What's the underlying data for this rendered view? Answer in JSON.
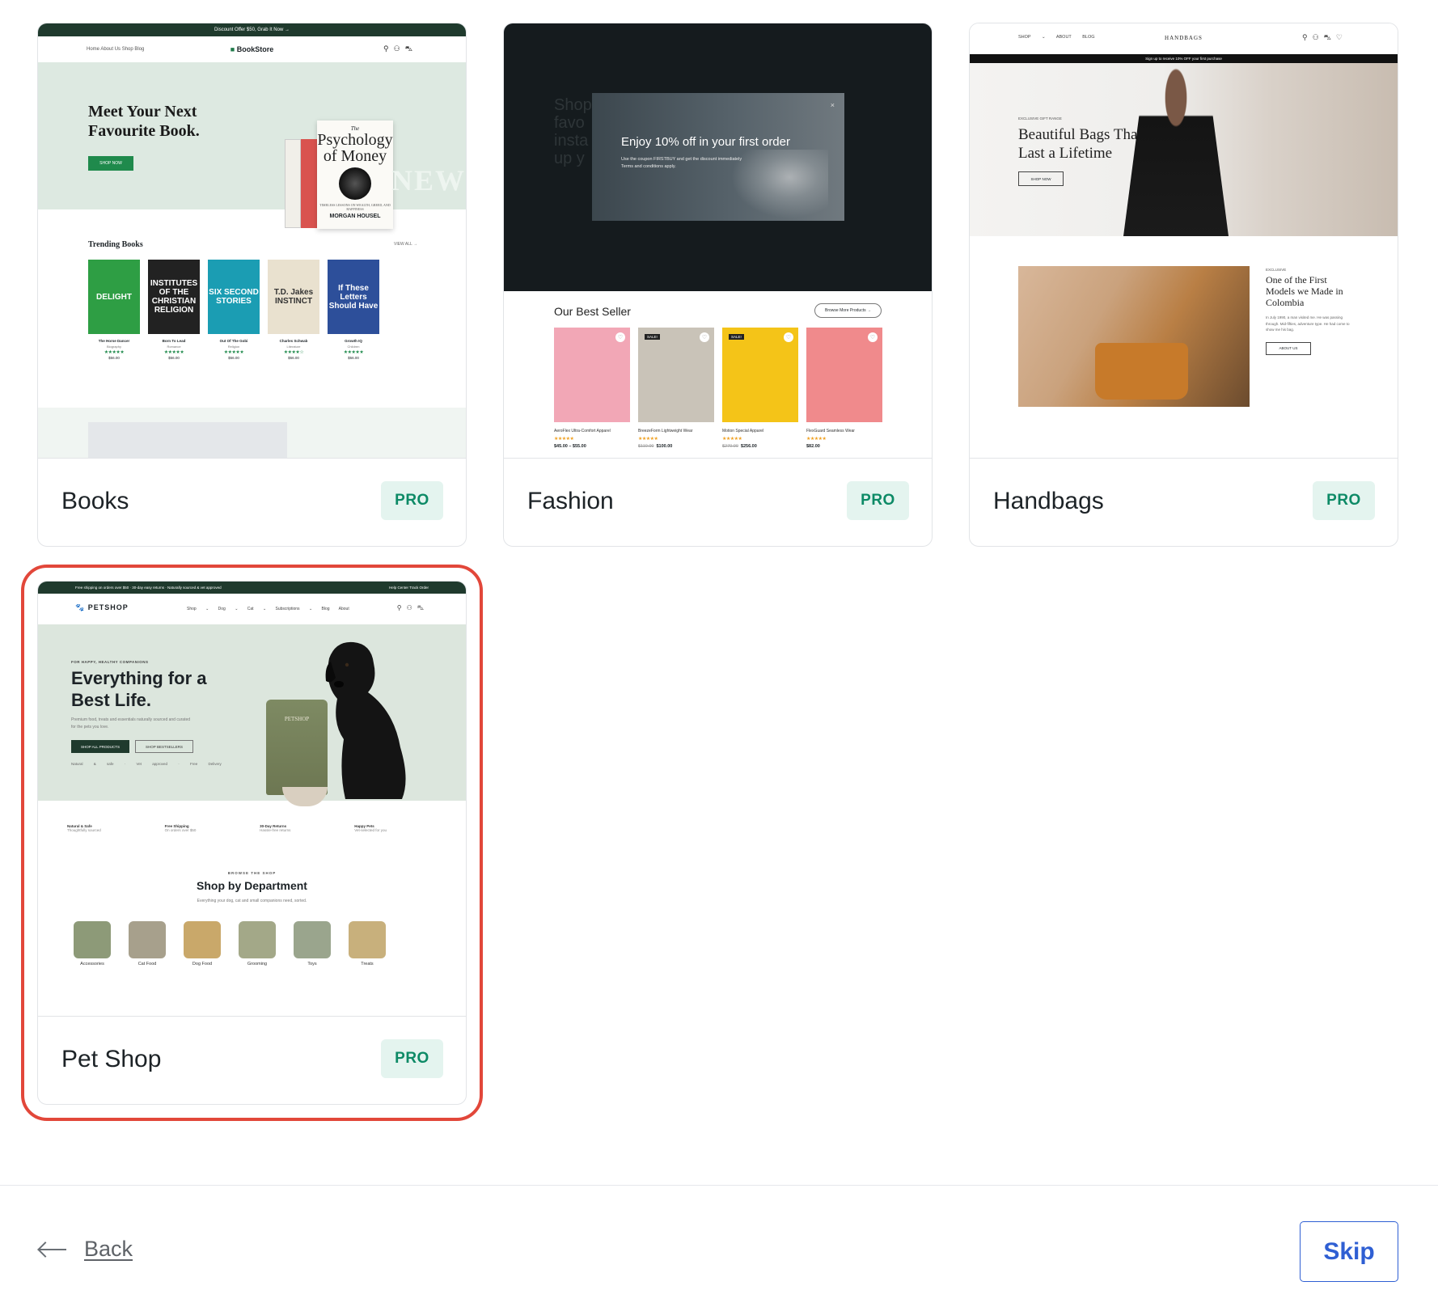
{
  "templates": [
    {
      "name": "Books",
      "badge": "PRO",
      "preview": {
        "topbar": "Discount Offer $50, Grab It Now →",
        "nav_links": "Home About Us Shop Blog",
        "logo": "BookStore",
        "hero_title": "Meet Your Next Favourite Book.",
        "hero_button": "SHOP NOW",
        "book_title_small": "The",
        "book_title": "Psychology of Money",
        "book_sub": "TIMELESS LESSONS ON WEALTH, GREED, AND HAPPINESS",
        "book_author": "MORGAN HOUSEL",
        "new_text": "NEW",
        "section_title": "Trending Books",
        "view_all": "VIEW ALL →",
        "books": [
          {
            "cover": "DELIGHT",
            "name": "The Horse Dancer",
            "cat": "Biography",
            "stars": "★★★★★",
            "price": "$56.00",
            "color": "#2e9e44"
          },
          {
            "cover": "INSTITUTES OF THE CHRISTIAN RELIGION",
            "name": "Born To Lead",
            "cat": "Romance",
            "stars": "★★★★★",
            "price": "$56.00",
            "color": "#222222"
          },
          {
            "cover": "SIX SECOND STORIES",
            "name": "Out Of The Gobi",
            "cat": "Religion",
            "stars": "★★★★★",
            "price": "$56.00",
            "color": "#1b9db3"
          },
          {
            "cover": "T.D. Jakes INSTINCT",
            "name": "Charles Schwab",
            "cat": "Literature",
            "stars": "★★★★☆",
            "price": "$56.00",
            "color": "#e9e1cf"
          },
          {
            "cover": "If These Letters Should Have",
            "name": "Growth IQ",
            "cat": "Children",
            "stars": "★★★★★",
            "price": "$56.00",
            "color": "#2d4f9a"
          }
        ]
      }
    },
    {
      "name": "Fashion",
      "badge": "PRO",
      "preview": {
        "ghost_text": "Shop favo insta up y",
        "modal_title": "Enjoy 10% off in your first order",
        "modal_text": "Use the coupon FIRSTBUY and get the discount immediately",
        "modal_terms": "Terms and conditions apply.",
        "modal_close": "×",
        "section_title": "Our Best Seller",
        "browse_button": "Browse More Products →",
        "products": [
          {
            "name": "AeroFlex Ultra-Comfort Apparel",
            "stars": "★★★★★",
            "old_price": "",
            "price": "$45.00 – $55.00",
            "sale": "",
            "color": "#f2a7b6"
          },
          {
            "name": "BreezeForm Lightweight Wear",
            "stars": "★★★★★",
            "old_price": "$110.00",
            "price": "$100.00",
            "sale": "SALE!",
            "color": "#c9c3b8"
          },
          {
            "name": "Motion Special Apparel",
            "stars": "★★★★★",
            "old_price": "$270.00",
            "price": "$256.00",
            "sale": "SALE!",
            "color": "#f4c418"
          },
          {
            "name": "FlexGuard Seamless Wear",
            "stars": "★★★★★",
            "old_price": "",
            "price": "$82.00",
            "sale": "",
            "color": "#f08a8c"
          }
        ]
      }
    },
    {
      "name": "Handbags",
      "badge": "PRO",
      "preview": {
        "nav_links": "SHOP ⌄ ABOUT BLOG",
        "logo": "HANDBAGS",
        "announcement": "Sign up to receive 10% OFF your first purchase",
        "kicker": "EXCLUSIVE GIFT RANGE",
        "hero_title": "Beautiful Bags That Last a Lifetime",
        "hero_button": "SHOP NOW",
        "kicker2": "EXCLUSIVE",
        "story_title": "One of the First Models we Made in Colombia",
        "story_text": "In July 1990, a man visited me. He was passing through. Mid-fifties, adventure type. He had come to show me his bag.",
        "story_button": "ABOUT US"
      }
    },
    {
      "name": "Pet Shop",
      "badge": "PRO",
      "selected": true,
      "preview": {
        "topbar_left": "Free shipping on orders over $50 · 30-day easy returns · Naturally sourced & vet approved",
        "topbar_right": "Help Center   Track Order",
        "logo": "PETSHOP",
        "nav_links": "Shop ⌄ Dog ⌄ Cat ⌄ Subscriptions ⌄ Blog About",
        "kicker": "FOR HAPPY, HEALTHY COMPANIONS",
        "hero_title": "Everything for a Best Life.",
        "hero_text": "Premium food, treats and essentials naturally sourced and curated for the pets you love.",
        "button_primary": "SHOP ALL PRODUCTS",
        "button_secondary": "SHOP BESTSELLERS",
        "hero_features": "Natural & safe · Vet approved · Free Delivery",
        "bag_label": "PETSHOP",
        "features": [
          {
            "title": "Natural & Safe",
            "sub": "Thoughtfully sourced"
          },
          {
            "title": "Free Shipping",
            "sub": "On orders over $50"
          },
          {
            "title": "30-Day Returns",
            "sub": "Hassle-free returns"
          },
          {
            "title": "Happy Pets",
            "sub": "Vet-selected for you"
          }
        ],
        "browse_kicker": "BROWSE THE SHOP",
        "section_title": "Shop by Department",
        "section_sub": "Everything your dog, cat and small companions need, sorted.",
        "departments": [
          {
            "label": "Accessories",
            "color": "#8d9a78"
          },
          {
            "label": "Cat Food",
            "color": "#a7a08c"
          },
          {
            "label": "Dog Food",
            "color": "#c9a86a"
          },
          {
            "label": "Grooming",
            "color": "#a3a888"
          },
          {
            "label": "Toys",
            "color": "#9aa58d"
          },
          {
            "label": "Treats",
            "color": "#c8b07c"
          }
        ]
      }
    }
  ],
  "footer": {
    "back_label": "Back",
    "skip_label": "Skip"
  },
  "colors": {
    "selection_outline": "#e2473a",
    "pro_badge_bg": "#e4f4ef",
    "pro_badge_text": "#0d8a66",
    "skip_button": "#2f5fd3"
  }
}
